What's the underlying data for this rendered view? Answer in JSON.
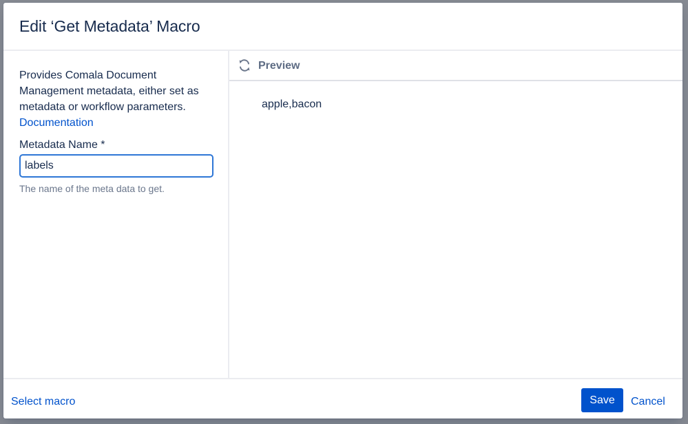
{
  "dialog": {
    "title": "Edit ‘Get Metadata’ Macro"
  },
  "macro": {
    "description": "Provides Comala Document Management metadata, either set as metadata or workflow parameters.",
    "documentation_link": "Documentation"
  },
  "field": {
    "label": "Metadata Name *",
    "value": "labels",
    "help": "The name of the meta data to get."
  },
  "preview": {
    "icon": "refresh-icon",
    "title": "Preview",
    "content": "apple,bacon"
  },
  "footer": {
    "select_macro": "Select macro",
    "save": "Save",
    "cancel": "Cancel"
  },
  "colors": {
    "primary": "#0052cc",
    "text": "#172b4d",
    "muted": "#6b778c",
    "focus_border": "#2d76d6"
  }
}
